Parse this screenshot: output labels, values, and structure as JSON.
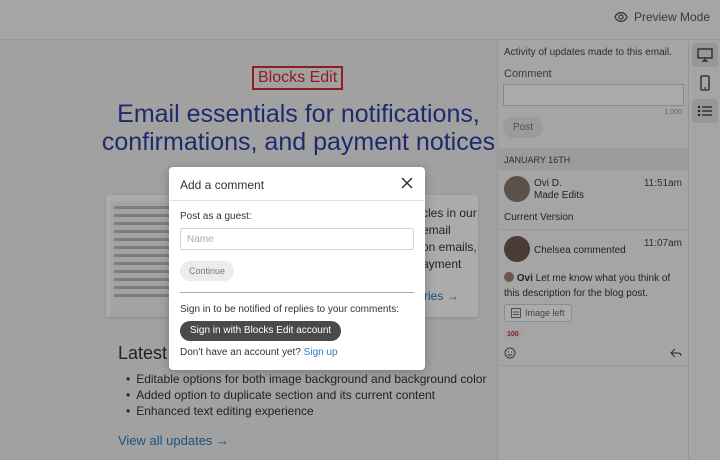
{
  "topbar": {
    "preview_label": "Preview Mode",
    "preview_icon": "eye-icon"
  },
  "email": {
    "logo_text": "Blocks Edit",
    "hero_title": "Email essentials for notifications, confirmations, and payment notices",
    "card_text_lines": [
      "cles in our",
      "email",
      "on emails,",
      "ayment"
    ],
    "card_link": "ries →",
    "latest_heading": "Latest",
    "bullets": [
      "Editable options for both image background and background color",
      "Added option to duplicate section and its current content",
      "Enhanced text editing experience"
    ],
    "view_all": "View all updates →"
  },
  "panel": {
    "header": "Activity of updates made to this email.",
    "comment_label": "Comment",
    "char_count": "1,000",
    "post_label": "Post",
    "date_header": "JANUARY 16TH",
    "entries": [
      {
        "name": "Ovi D.",
        "action": "Made Edits",
        "time": "11:51am",
        "detail": "Current Version"
      },
      {
        "name": "Chelsea commented",
        "time": "11:07am",
        "author": "Ovi",
        "message": " Let me know what you think of this description for the blog post.",
        "chip_label": "Image left",
        "emoji_tag": "100"
      }
    ]
  },
  "device_bar": {
    "buttons": [
      "desktop-icon",
      "mobile-icon",
      "list-icon"
    ]
  },
  "modal": {
    "title": "Add a comment",
    "guest_label": "Post as a guest:",
    "name_placeholder": "Name",
    "continue_label": "Continue",
    "signin_note": "Sign in to be notified of replies to your comments:",
    "signin_button": "Sign in with Blocks Edit account",
    "signup_prompt": "Don't have an account yet? ",
    "signup_link": "Sign up"
  },
  "colors": {
    "brand_red": "#d0312d",
    "heading_blue": "#2f3fa5",
    "link_blue": "#2b7bbd",
    "dark_button": "#4a4a4a"
  }
}
